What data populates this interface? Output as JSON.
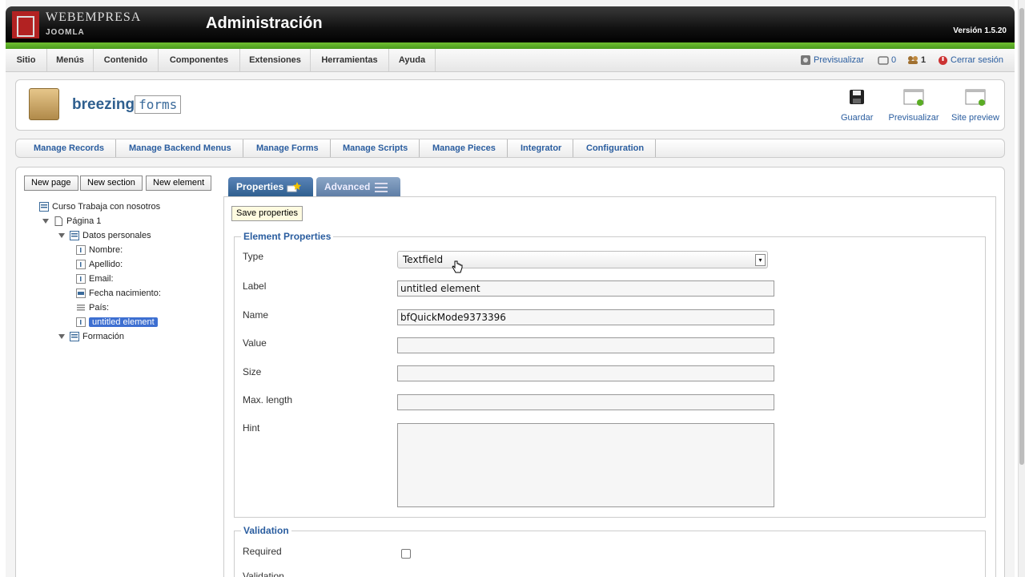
{
  "header": {
    "brand_top": "WEBEMPRESA",
    "brand_bottom": "JOOMLA",
    "title": "Administración",
    "version": "Versión 1.5.20"
  },
  "menu": {
    "items": [
      {
        "label": "Sitio"
      },
      {
        "label": "Menús"
      },
      {
        "label": "Contenido"
      },
      {
        "label": "Componentes"
      },
      {
        "label": "Extensiones"
      },
      {
        "label": "Herramientas"
      },
      {
        "label": "Ayuda"
      }
    ],
    "status": {
      "preview_label": "Previsualizar",
      "messages_count": "0",
      "users_count": "1",
      "logout_label": "Cerrar sesión"
    }
  },
  "component": {
    "logo_text": "breezing",
    "logo_forms": "forms",
    "toolbar": {
      "save_label": "Guardar",
      "preview_label": "Previsualizar",
      "site_preview_label": "Site preview"
    }
  },
  "submenu": {
    "items": [
      {
        "label": "Manage Records"
      },
      {
        "label": "Manage Backend Menus"
      },
      {
        "label": "Manage Forms"
      },
      {
        "label": "Manage Scripts"
      },
      {
        "label": "Manage Pieces"
      },
      {
        "label": "Integrator"
      },
      {
        "label": "Configuration"
      }
    ]
  },
  "left": {
    "new_page": "New page",
    "new_section": "New section",
    "new_element": "New element",
    "tree": {
      "root": "Curso Trabaja con nosotros",
      "page": "Página 1",
      "section1": "Datos personales",
      "elements": [
        "Nombre:",
        "Apellido:",
        "Email:",
        "Fecha nacimiento:",
        "País:",
        "untitled element"
      ],
      "section2": "Formación"
    }
  },
  "tabs": {
    "properties": "Properties",
    "advanced": "Advanced"
  },
  "form": {
    "save_properties": "Save properties",
    "element_properties_legend": "Element Properties",
    "type_label": "Type",
    "type_value": "Textfield",
    "label_label": "Label",
    "label_value": "untitled element",
    "name_label": "Name",
    "name_value": "bfQuickMode9373396",
    "value_label": "Value",
    "size_label": "Size",
    "maxlength_label": "Max. length",
    "hint_label": "Hint",
    "validation_legend": "Validation",
    "required_label": "Required",
    "required_checked": false,
    "validation_label": "Validation"
  },
  "colors": {
    "accent": "#2a5d9f",
    "header_green": "#5aac24",
    "selected": "#3d6fd1"
  }
}
